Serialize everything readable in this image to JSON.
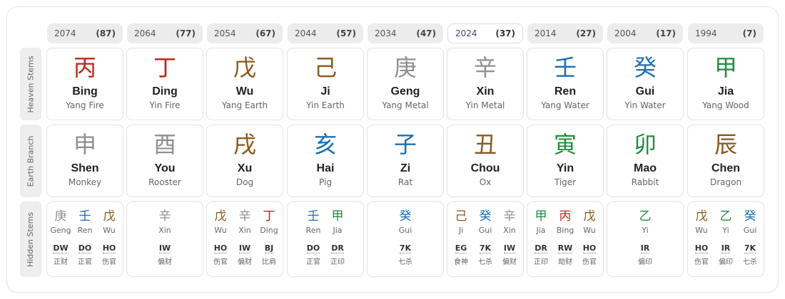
{
  "row_labels": {
    "heaven": "Heaven Stems",
    "earth": "Earth Branch",
    "hidden": "Hidden Stems"
  },
  "colors": {
    "fire": "#c0261a",
    "earth": "#8a5a1d",
    "metal": "#8f8f8f",
    "water": "#1b6fb4",
    "wood": "#1f8f3c"
  },
  "active_index": 5,
  "pillars": [
    {
      "year": "2074",
      "age": "(87)",
      "stem": {
        "char": "丙",
        "name": "Bing",
        "desc": "Yang Fire",
        "color": "#c0261a"
      },
      "branch": {
        "char": "申",
        "name": "Shen",
        "desc": "Monkey",
        "color": "#8f8f8f"
      },
      "hidden": [
        {
          "char": "庚",
          "name": "Geng",
          "abbr": "DW",
          "zh": "正财",
          "color": "#8f8f8f"
        },
        {
          "char": "壬",
          "name": "Ren",
          "abbr": "DO",
          "zh": "正官",
          "color": "#1b6fb4"
        },
        {
          "char": "戊",
          "name": "Wu",
          "abbr": "HO",
          "zh": "伤官",
          "color": "#8a5a1d"
        }
      ]
    },
    {
      "year": "2064",
      "age": "(77)",
      "stem": {
        "char": "丁",
        "name": "Ding",
        "desc": "Yin Fire",
        "color": "#c0261a"
      },
      "branch": {
        "char": "酉",
        "name": "You",
        "desc": "Rooster",
        "color": "#8f8f8f"
      },
      "hidden": [
        {
          "char": "辛",
          "name": "Xin",
          "abbr": "IW",
          "zh": "偏财",
          "color": "#8f8f8f"
        }
      ]
    },
    {
      "year": "2054",
      "age": "(67)",
      "stem": {
        "char": "戊",
        "name": "Wu",
        "desc": "Yang Earth",
        "color": "#8a5a1d"
      },
      "branch": {
        "char": "戌",
        "name": "Xu",
        "desc": "Dog",
        "color": "#8a5a1d"
      },
      "hidden": [
        {
          "char": "戊",
          "name": "Wu",
          "abbr": "HO",
          "zh": "伤官",
          "color": "#8a5a1d"
        },
        {
          "char": "辛",
          "name": "Xin",
          "abbr": "IW",
          "zh": "偏财",
          "color": "#8f8f8f"
        },
        {
          "char": "丁",
          "name": "Ding",
          "abbr": "BJ",
          "zh": "比肩",
          "color": "#c0261a"
        }
      ]
    },
    {
      "year": "2044",
      "age": "(57)",
      "stem": {
        "char": "己",
        "name": "Ji",
        "desc": "Yin Earth",
        "color": "#8a5a1d"
      },
      "branch": {
        "char": "亥",
        "name": "Hai",
        "desc": "Pig",
        "color": "#1b6fb4"
      },
      "hidden": [
        {
          "char": "壬",
          "name": "Ren",
          "abbr": "DO",
          "zh": "正官",
          "color": "#1b6fb4"
        },
        {
          "char": "甲",
          "name": "Jia",
          "abbr": "DR",
          "zh": "正印",
          "color": "#1f8f3c"
        }
      ]
    },
    {
      "year": "2034",
      "age": "(47)",
      "stem": {
        "char": "庚",
        "name": "Geng",
        "desc": "Yang Metal",
        "color": "#8f8f8f"
      },
      "branch": {
        "char": "子",
        "name": "Zi",
        "desc": "Rat",
        "color": "#1b6fb4"
      },
      "hidden": [
        {
          "char": "癸",
          "name": "Gui",
          "abbr": "7K",
          "zh": "七杀",
          "color": "#1b6fb4"
        }
      ]
    },
    {
      "year": "2024",
      "age": "(37)",
      "stem": {
        "char": "辛",
        "name": "Xin",
        "desc": "Yin Metal",
        "color": "#8f8f8f"
      },
      "branch": {
        "char": "丑",
        "name": "Chou",
        "desc": "Ox",
        "color": "#8a5a1d"
      },
      "hidden": [
        {
          "char": "己",
          "name": "Ji",
          "abbr": "EG",
          "zh": "食神",
          "color": "#8a5a1d"
        },
        {
          "char": "癸",
          "name": "Gui",
          "abbr": "7K",
          "zh": "七杀",
          "color": "#1b6fb4"
        },
        {
          "char": "辛",
          "name": "Xin",
          "abbr": "IW",
          "zh": "偏财",
          "color": "#8f8f8f"
        }
      ]
    },
    {
      "year": "2014",
      "age": "(27)",
      "stem": {
        "char": "壬",
        "name": "Ren",
        "desc": "Yang Water",
        "color": "#1b6fb4"
      },
      "branch": {
        "char": "寅",
        "name": "Yin",
        "desc": "Tiger",
        "color": "#1f8f3c"
      },
      "hidden": [
        {
          "char": "甲",
          "name": "Jia",
          "abbr": "DR",
          "zh": "正印",
          "color": "#1f8f3c"
        },
        {
          "char": "丙",
          "name": "Bing",
          "abbr": "RW",
          "zh": "劫财",
          "color": "#c0261a"
        },
        {
          "char": "戊",
          "name": "Wu",
          "abbr": "HO",
          "zh": "伤官",
          "color": "#8a5a1d"
        }
      ]
    },
    {
      "year": "2004",
      "age": "(17)",
      "stem": {
        "char": "癸",
        "name": "Gui",
        "desc": "Yin Water",
        "color": "#1b6fb4"
      },
      "branch": {
        "char": "卯",
        "name": "Mao",
        "desc": "Rabbit",
        "color": "#1f8f3c"
      },
      "hidden": [
        {
          "char": "乙",
          "name": "Yi",
          "abbr": "IR",
          "zh": "偏印",
          "color": "#1f8f3c"
        }
      ]
    },
    {
      "year": "1994",
      "age": "(7)",
      "stem": {
        "char": "甲",
        "name": "Jia",
        "desc": "Yang Wood",
        "color": "#1f8f3c"
      },
      "branch": {
        "char": "辰",
        "name": "Chen",
        "desc": "Dragon",
        "color": "#8a5a1d"
      },
      "hidden": [
        {
          "char": "戊",
          "name": "Wu",
          "abbr": "HO",
          "zh": "伤官",
          "color": "#8a5a1d"
        },
        {
          "char": "乙",
          "name": "Yi",
          "abbr": "IR",
          "zh": "偏印",
          "color": "#1f8f3c"
        },
        {
          "char": "癸",
          "name": "Gui",
          "abbr": "7K",
          "zh": "七杀",
          "color": "#1b6fb4"
        }
      ]
    }
  ]
}
